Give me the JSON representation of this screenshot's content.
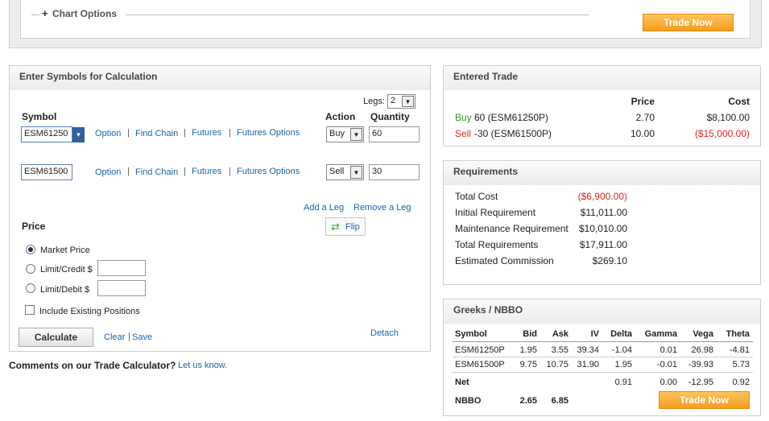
{
  "chart_options": {
    "label": "Chart Options",
    "expand_glyph": "+",
    "trade_now": "Trade Now"
  },
  "calc": {
    "title": "Enter Symbols for Calculation",
    "legs_label": "Legs:",
    "legs_value": "2",
    "col_symbol": "Symbol",
    "col_action": "Action",
    "col_quantity": "Quantity",
    "rows": [
      {
        "symbol": "ESM61250",
        "action": "Buy",
        "quantity": "60"
      },
      {
        "symbol": "ESM61500",
        "action": "Sell",
        "quantity": "30"
      }
    ],
    "links": {
      "option": "Option",
      "find_chain": "Find Chain",
      "futures": "Futures",
      "futures_options": "Futures Options",
      "sep": "|"
    },
    "add_leg": "Add a Leg",
    "remove_leg": "Remove a Leg",
    "flip": "Flip",
    "price_label": "Price",
    "market_price": "Market Price",
    "limit_credit": "Limit/Credit $",
    "limit_debit": "Limit/Debit $",
    "include_positions": "Include Existing Positions",
    "calculate": "Calculate",
    "clear": "Clear",
    "save": "Save",
    "clear_save_sep": "|",
    "detach": "Detach"
  },
  "comments": {
    "text": "Comments on our Trade Calculator?",
    "link": "Let us know."
  },
  "entered_trade": {
    "title": "Entered Trade",
    "col_price": "Price",
    "col_cost": "Cost",
    "rows": [
      {
        "side": "Buy",
        "desc": "60 (ESM61250P)",
        "price": "2.70",
        "cost": "$8,100.00"
      },
      {
        "side": "Sell",
        "desc": "-30 (ESM61500P)",
        "price": "10.00",
        "cost": "($15,000.00)"
      }
    ]
  },
  "requirements": {
    "title": "Requirements",
    "rows": [
      {
        "label": "Total Cost",
        "value": "($6,900.00)"
      },
      {
        "label": "Initial Requirement",
        "value": "$11,011.00"
      },
      {
        "label": "Maintenance Requirement",
        "value": "$10,010.00"
      },
      {
        "label": "Total Requirements",
        "value": "$17,911.00"
      },
      {
        "label": "Estimated Commission",
        "value": "$269.10"
      }
    ]
  },
  "greeks": {
    "title": "Greeks / NBBO",
    "headers": [
      "Symbol",
      "Bid",
      "Ask",
      "IV",
      "Delta",
      "Gamma",
      "Vega",
      "Theta"
    ],
    "rows": [
      [
        "ESM61250P",
        "1.95",
        "3.55",
        "39.34",
        "-1.04",
        "0.01",
        "26.98",
        "-4.81"
      ],
      [
        "ESM61500P",
        "9.75",
        "10.75",
        "31.90",
        "1.95",
        "-0.01",
        "-39.93",
        "5.73"
      ]
    ],
    "net": {
      "label": "Net",
      "delta": "0.91",
      "gamma": "0.00",
      "vega": "-12.95",
      "theta": "0.92"
    },
    "nbbo": {
      "label": "NBBO",
      "bid": "2.65",
      "ask": "6.85"
    },
    "trade_now": "Trade Now"
  },
  "colors": {
    "accent_orange": "#f59c1c",
    "link_blue": "#1a66a8",
    "buy_green": "#2a9a2a",
    "sell_red": "#e0261f"
  }
}
